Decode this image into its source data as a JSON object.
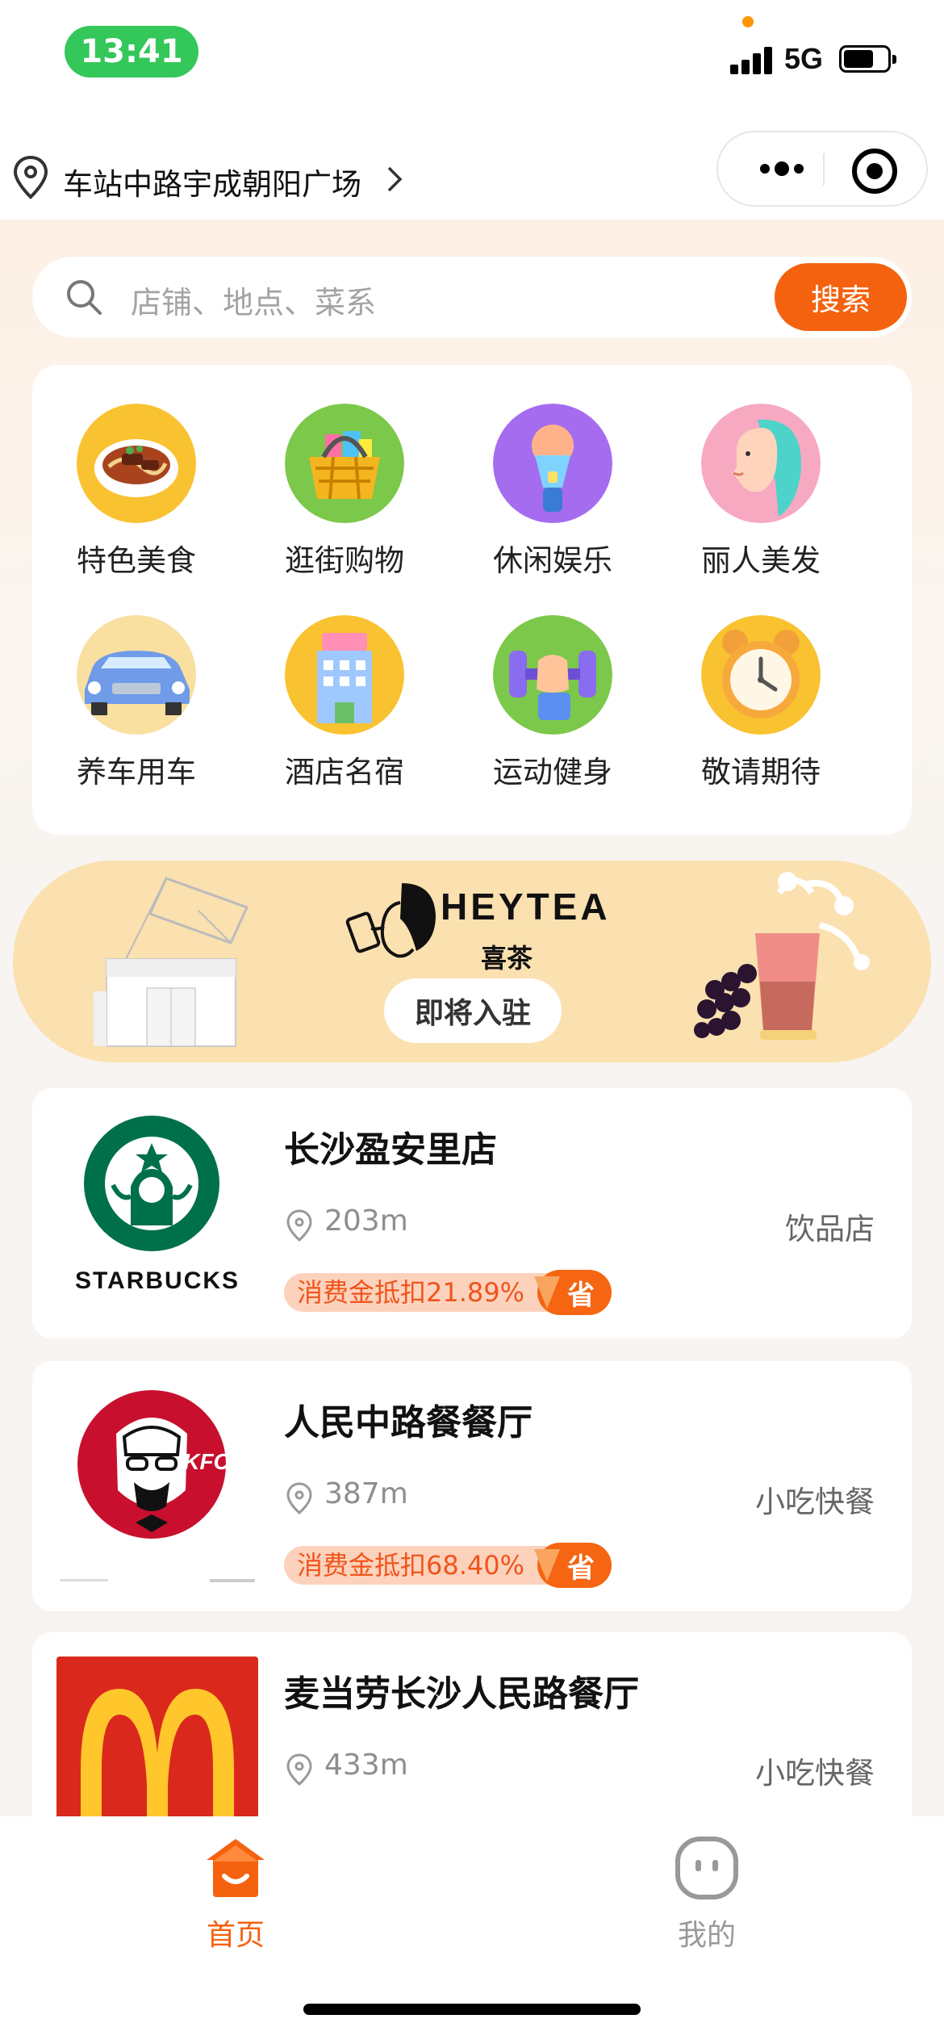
{
  "status_bar": {
    "time": "13:41",
    "network": "5G",
    "battery_level": 0.7
  },
  "header": {
    "location": "车站中路宇成朝阳广场"
  },
  "search": {
    "placeholder": "店铺、地点、菜系",
    "button": "搜索"
  },
  "categories": [
    {
      "label": "特色美食",
      "icon": "noodle-bowl-icon"
    },
    {
      "label": "逛街购物",
      "icon": "shopping-basket-icon"
    },
    {
      "label": "休闲娱乐",
      "icon": "microphone-icon"
    },
    {
      "label": "丽人美发",
      "icon": "woman-hair-icon"
    },
    {
      "label": "养车用车",
      "icon": "car-icon"
    },
    {
      "label": "酒店名宿",
      "icon": "hotel-icon"
    },
    {
      "label": "运动健身",
      "icon": "dumbbell-icon"
    },
    {
      "label": "敬请期待",
      "icon": "alarm-clock-icon"
    }
  ],
  "banner": {
    "brand": "HEYTEA",
    "brand_cn": "喜茶",
    "status": "即将入驻"
  },
  "stores": [
    {
      "name": "长沙盈安里店",
      "distance": "203m",
      "category": "饮品店",
      "coupon": "消费金抵扣21.89%",
      "badge": "省",
      "logo": "starbucks-logo",
      "logo_text": "STARBUCKS"
    },
    {
      "name": "人民中路餐餐厅",
      "distance": "387m",
      "category": "小吃快餐",
      "coupon": "消费金抵扣68.40%",
      "badge": "省",
      "logo": "kfc-logo",
      "logo_text": "KFC"
    },
    {
      "name": "麦当劳长沙人民路餐厅",
      "distance": "433m",
      "category": "小吃快餐",
      "coupon": "",
      "badge": "",
      "logo": "mcdonalds-logo",
      "logo_text": ""
    }
  ],
  "tabbar": [
    {
      "label": "首页",
      "icon": "home-icon",
      "active": true
    },
    {
      "label": "我的",
      "icon": "profile-icon",
      "active": false
    }
  ],
  "colors": {
    "accent": "#f5620f",
    "coupon_bg": "#fcd2bd",
    "coupon_text": "#f0541a",
    "banner_bg": "#fbe0b0",
    "status_pill": "#34c759"
  }
}
